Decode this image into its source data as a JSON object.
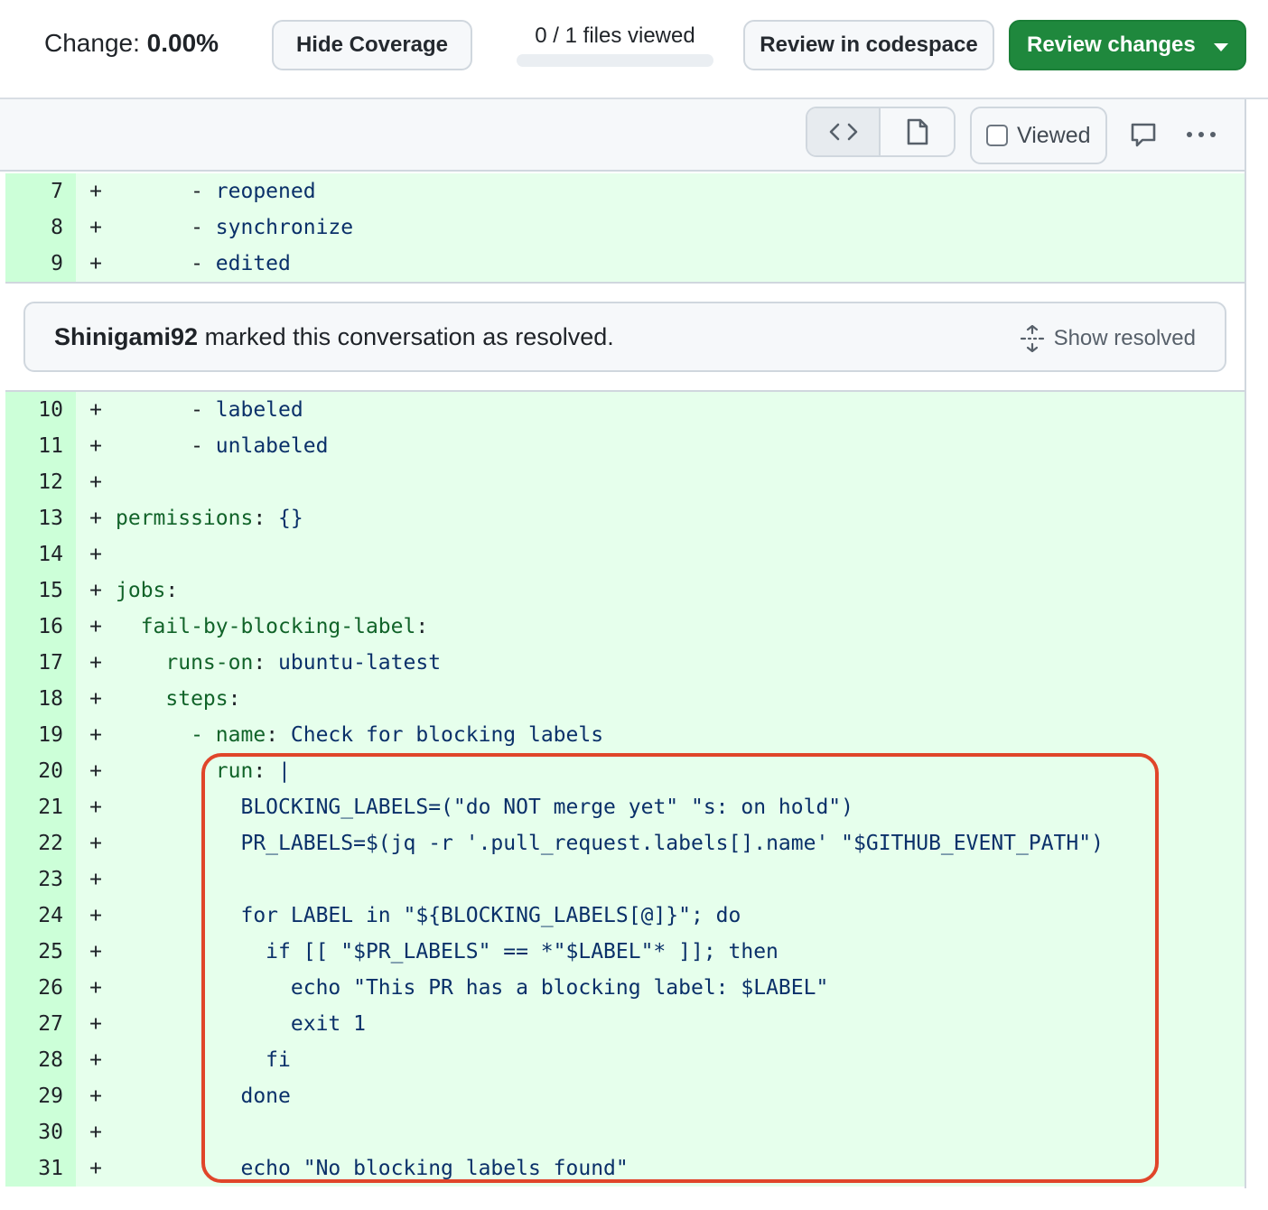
{
  "toolbar": {
    "change_label": "Change:",
    "change_value": "0.00%",
    "hide_coverage": "Hide Coverage",
    "files_viewed": "0 / 1 files viewed",
    "review_codespace": "Review in codespace",
    "review_changes": "Review changes"
  },
  "file_header": {
    "viewed_label": "Viewed",
    "icons": [
      "code-icon",
      "file-icon",
      "comment-icon",
      "kebab-horizontal-icon"
    ]
  },
  "resolved": {
    "user": "Shinigami92",
    "message": "marked this conversation as resolved.",
    "show_resolved": "Show resolved"
  },
  "diff": {
    "marker": "+",
    "lines_before": [
      {
        "n": "7",
        "indent": "      ",
        "key": "",
        "sep": "- ",
        "val": "reopened"
      },
      {
        "n": "8",
        "indent": "      ",
        "key": "",
        "sep": "- ",
        "val": "synchronize"
      },
      {
        "n": "9",
        "indent": "      ",
        "key": "",
        "sep": "- ",
        "val": "edited"
      }
    ],
    "lines_after": [
      {
        "n": "10",
        "indent": "      ",
        "key": "",
        "sep": "- ",
        "val": "labeled"
      },
      {
        "n": "11",
        "indent": "      ",
        "key": "",
        "sep": "- ",
        "val": "unlabeled"
      },
      {
        "n": "12",
        "indent": "",
        "key": "",
        "sep": "",
        "val": ""
      },
      {
        "n": "13",
        "indent": "",
        "key": "permissions",
        "sep": ": ",
        "val": "{}"
      },
      {
        "n": "14",
        "indent": "",
        "key": "",
        "sep": "",
        "val": ""
      },
      {
        "n": "15",
        "indent": "",
        "key": "jobs",
        "sep": ":",
        "val": ""
      },
      {
        "n": "16",
        "indent": "  ",
        "key": "fail-by-blocking-label",
        "sep": ":",
        "val": ""
      },
      {
        "n": "17",
        "indent": "    ",
        "key": "runs-on",
        "sep": ": ",
        "val": "ubuntu-latest"
      },
      {
        "n": "18",
        "indent": "    ",
        "key": "steps",
        "sep": ":",
        "val": ""
      },
      {
        "n": "19",
        "indent": "      ",
        "key": "- name",
        "sep": ": ",
        "val": "Check for blocking labels"
      },
      {
        "n": "20",
        "indent": "        ",
        "key": "run",
        "sep": ": ",
        "val": "|"
      },
      {
        "n": "21",
        "indent": "          ",
        "key": "",
        "sep": "",
        "val": "BLOCKING_LABELS=(\"do NOT merge yet\" \"s: on hold\")"
      },
      {
        "n": "22",
        "indent": "          ",
        "key": "",
        "sep": "",
        "val": "PR_LABELS=$(jq -r '.pull_request.labels[].name' \"$GITHUB_EVENT_PATH\")"
      },
      {
        "n": "23",
        "indent": "",
        "key": "",
        "sep": "",
        "val": ""
      },
      {
        "n": "24",
        "indent": "          ",
        "key": "",
        "sep": "",
        "val": "for LABEL in \"${BLOCKING_LABELS[@]}\"; do"
      },
      {
        "n": "25",
        "indent": "            ",
        "key": "",
        "sep": "",
        "val": "if [[ \"$PR_LABELS\" == *\"$LABEL\"* ]]; then"
      },
      {
        "n": "26",
        "indent": "              ",
        "key": "",
        "sep": "",
        "val": "echo \"This PR has a blocking label: $LABEL\""
      },
      {
        "n": "27",
        "indent": "              ",
        "key": "",
        "sep": "",
        "val": "exit 1"
      },
      {
        "n": "28",
        "indent": "            ",
        "key": "",
        "sep": "",
        "val": "fi"
      },
      {
        "n": "29",
        "indent": "          ",
        "key": "",
        "sep": "",
        "val": "done"
      },
      {
        "n": "30",
        "indent": "",
        "key": "",
        "sep": "",
        "val": ""
      },
      {
        "n": "31",
        "indent": "          ",
        "key": "",
        "sep": "",
        "val": "echo \"No blocking labels found\""
      }
    ]
  },
  "colors": {
    "add_num_bg": "#ccffd8",
    "add_code_bg": "#e6ffec",
    "primary_button": "#1f883d",
    "highlight_border": "#e0452a"
  }
}
